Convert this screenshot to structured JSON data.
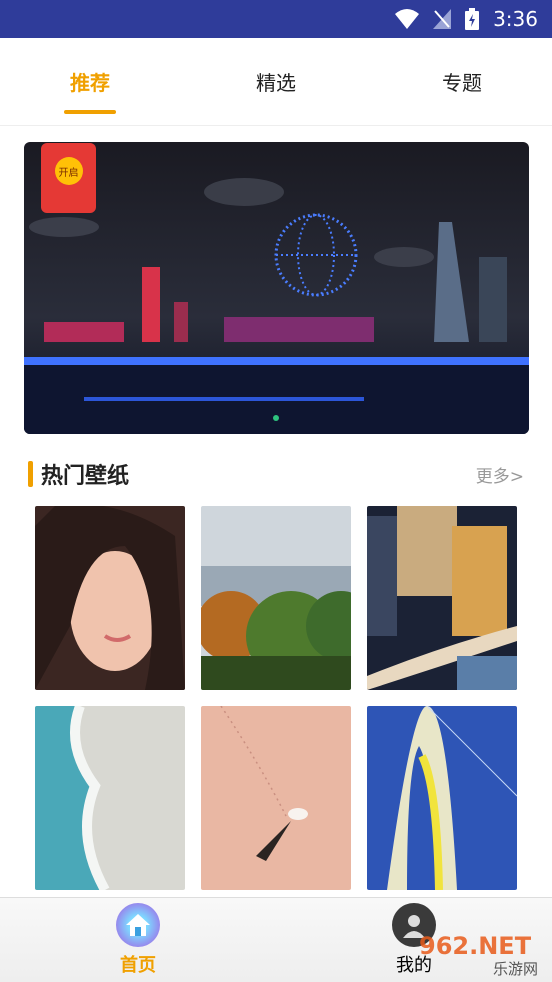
{
  "status_bar": {
    "time": "3:36"
  },
  "tabs": [
    {
      "label": "推荐",
      "active": true
    },
    {
      "label": "精选",
      "active": false
    },
    {
      "label": "专题",
      "active": false
    }
  ],
  "banner": {
    "envelope_label": "开启"
  },
  "section": {
    "title": "热门壁纸",
    "more": "更多>"
  },
  "wallpapers": [
    {
      "name": "portrait"
    },
    {
      "name": "trees"
    },
    {
      "name": "city-night"
    },
    {
      "name": "beach-waves"
    },
    {
      "name": "sand-umbrella"
    },
    {
      "name": "bridge-arch"
    }
  ],
  "bottom_nav": [
    {
      "label": "首页",
      "icon": "home-icon",
      "active": true
    },
    {
      "label": "我的",
      "icon": "user-icon",
      "active": false
    }
  ],
  "watermark": {
    "text": "962.NET",
    "subtext": "乐游网"
  },
  "colors": {
    "accent": "#f0a000",
    "status_bar": "#2f3c9a"
  }
}
